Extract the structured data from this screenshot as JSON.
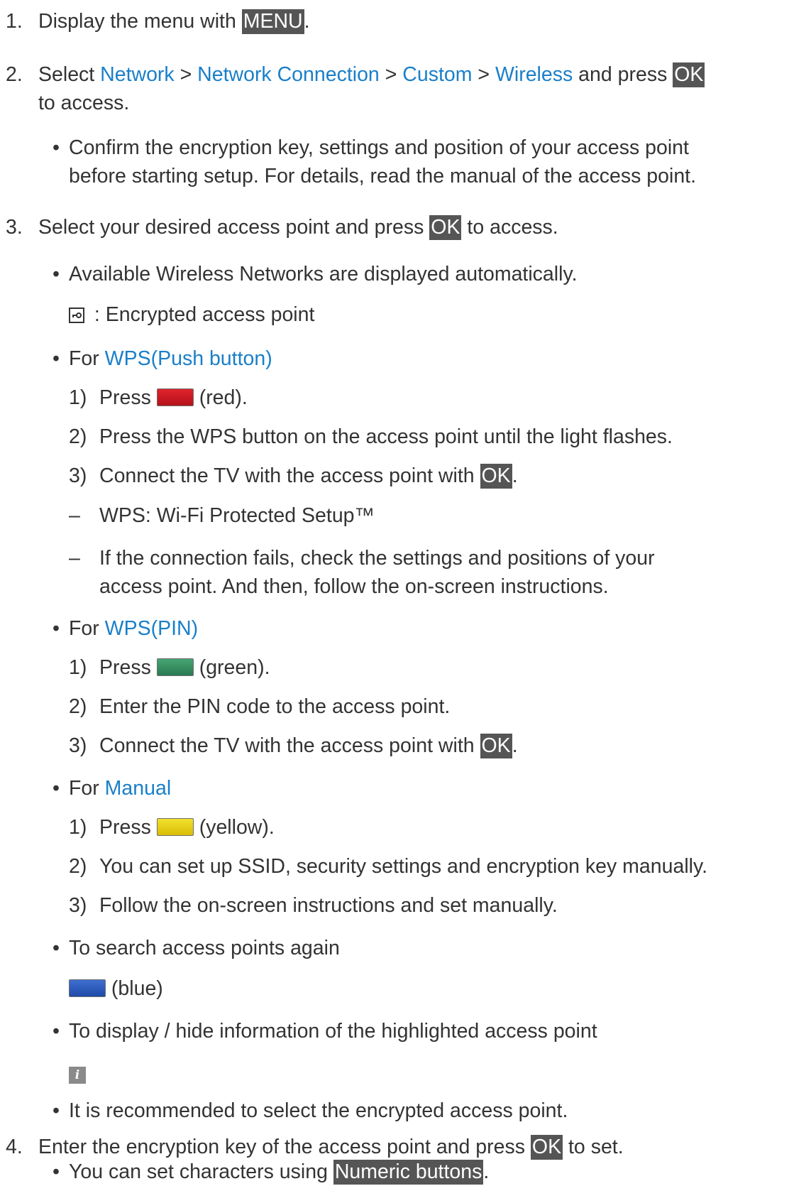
{
  "steps": {
    "s1": {
      "num": "1.",
      "pre": "Display the menu with ",
      "key": "MENU",
      "post": "."
    },
    "s2": {
      "num": "2.",
      "pre": "Select ",
      "path": [
        "Network",
        "Network Connection",
        "Custom",
        "Wireless"
      ],
      "sep": " > ",
      "mid": " and press ",
      "key": "OK",
      "cont": "to access.",
      "note": [
        "Confirm the encryption key, settings and position of your access point",
        "before starting setup. For details, read the manual of the access point."
      ]
    },
    "s3": {
      "num": "3.",
      "pre": "Select your desired access point and press ",
      "key": "OK",
      "post": " to access.",
      "b1": "Available Wireless Networks are displayed automatically.",
      "b1_icon_text": " : Encrypted access point",
      "wps_push": {
        "pre": "For ",
        "link": "WPS(Push button)",
        "steps": [
          {
            "n": "1)",
            "pre": "Press ",
            "color": "red",
            "post": " (red)."
          },
          {
            "n": "2)",
            "text": "Press the WPS button on the access point until the light flashes."
          },
          {
            "n": "3)",
            "pre": "Connect the TV with the access point with ",
            "key": "OK",
            "post": "."
          }
        ],
        "dashes": [
          "WPS: Wi-Fi Protected Setup™",
          "If the connection fails, check the settings and positions of your",
          "access point. And then, follow the on-screen instructions."
        ]
      },
      "wps_pin": {
        "pre": "For ",
        "link": "WPS(PIN)",
        "steps": [
          {
            "n": "1)",
            "pre": "Press ",
            "color": "green",
            "post": " (green)."
          },
          {
            "n": "2)",
            "text": "Enter the PIN code to the access point."
          },
          {
            "n": "3)",
            "pre": "Connect the TV with the access point with ",
            "key": "OK",
            "post": "."
          }
        ]
      },
      "manual": {
        "pre": "For ",
        "link": "Manual",
        "steps": [
          {
            "n": "1)",
            "pre": "Press ",
            "color": "yellow",
            "post": " (yellow)."
          },
          {
            "n": "2)",
            "text": "You can set up SSID, security settings and encryption key manually."
          },
          {
            "n": "3)",
            "text": "Follow the on-screen instructions and set manually."
          }
        ]
      },
      "search": {
        "text": "To search access points again",
        "color": "blue",
        "post": " (blue)"
      },
      "info": {
        "text": "To display / hide information of the highlighted access point",
        "icon": "i"
      },
      "recommend": "It is recommended to select the encrypted access point."
    },
    "s4": {
      "num": "4.",
      "pre": "Enter the encryption key of the access point and press ",
      "key": "OK",
      "post": " to set.",
      "b1_pre": "You can set characters using ",
      "b1_key": "Numeric buttons",
      "b1_post": "."
    }
  },
  "bullet_char": "•",
  "dash_char": "–",
  "colors": {
    "link": "#1a7fc9",
    "key_bg": "#555555",
    "text": "#333333"
  }
}
